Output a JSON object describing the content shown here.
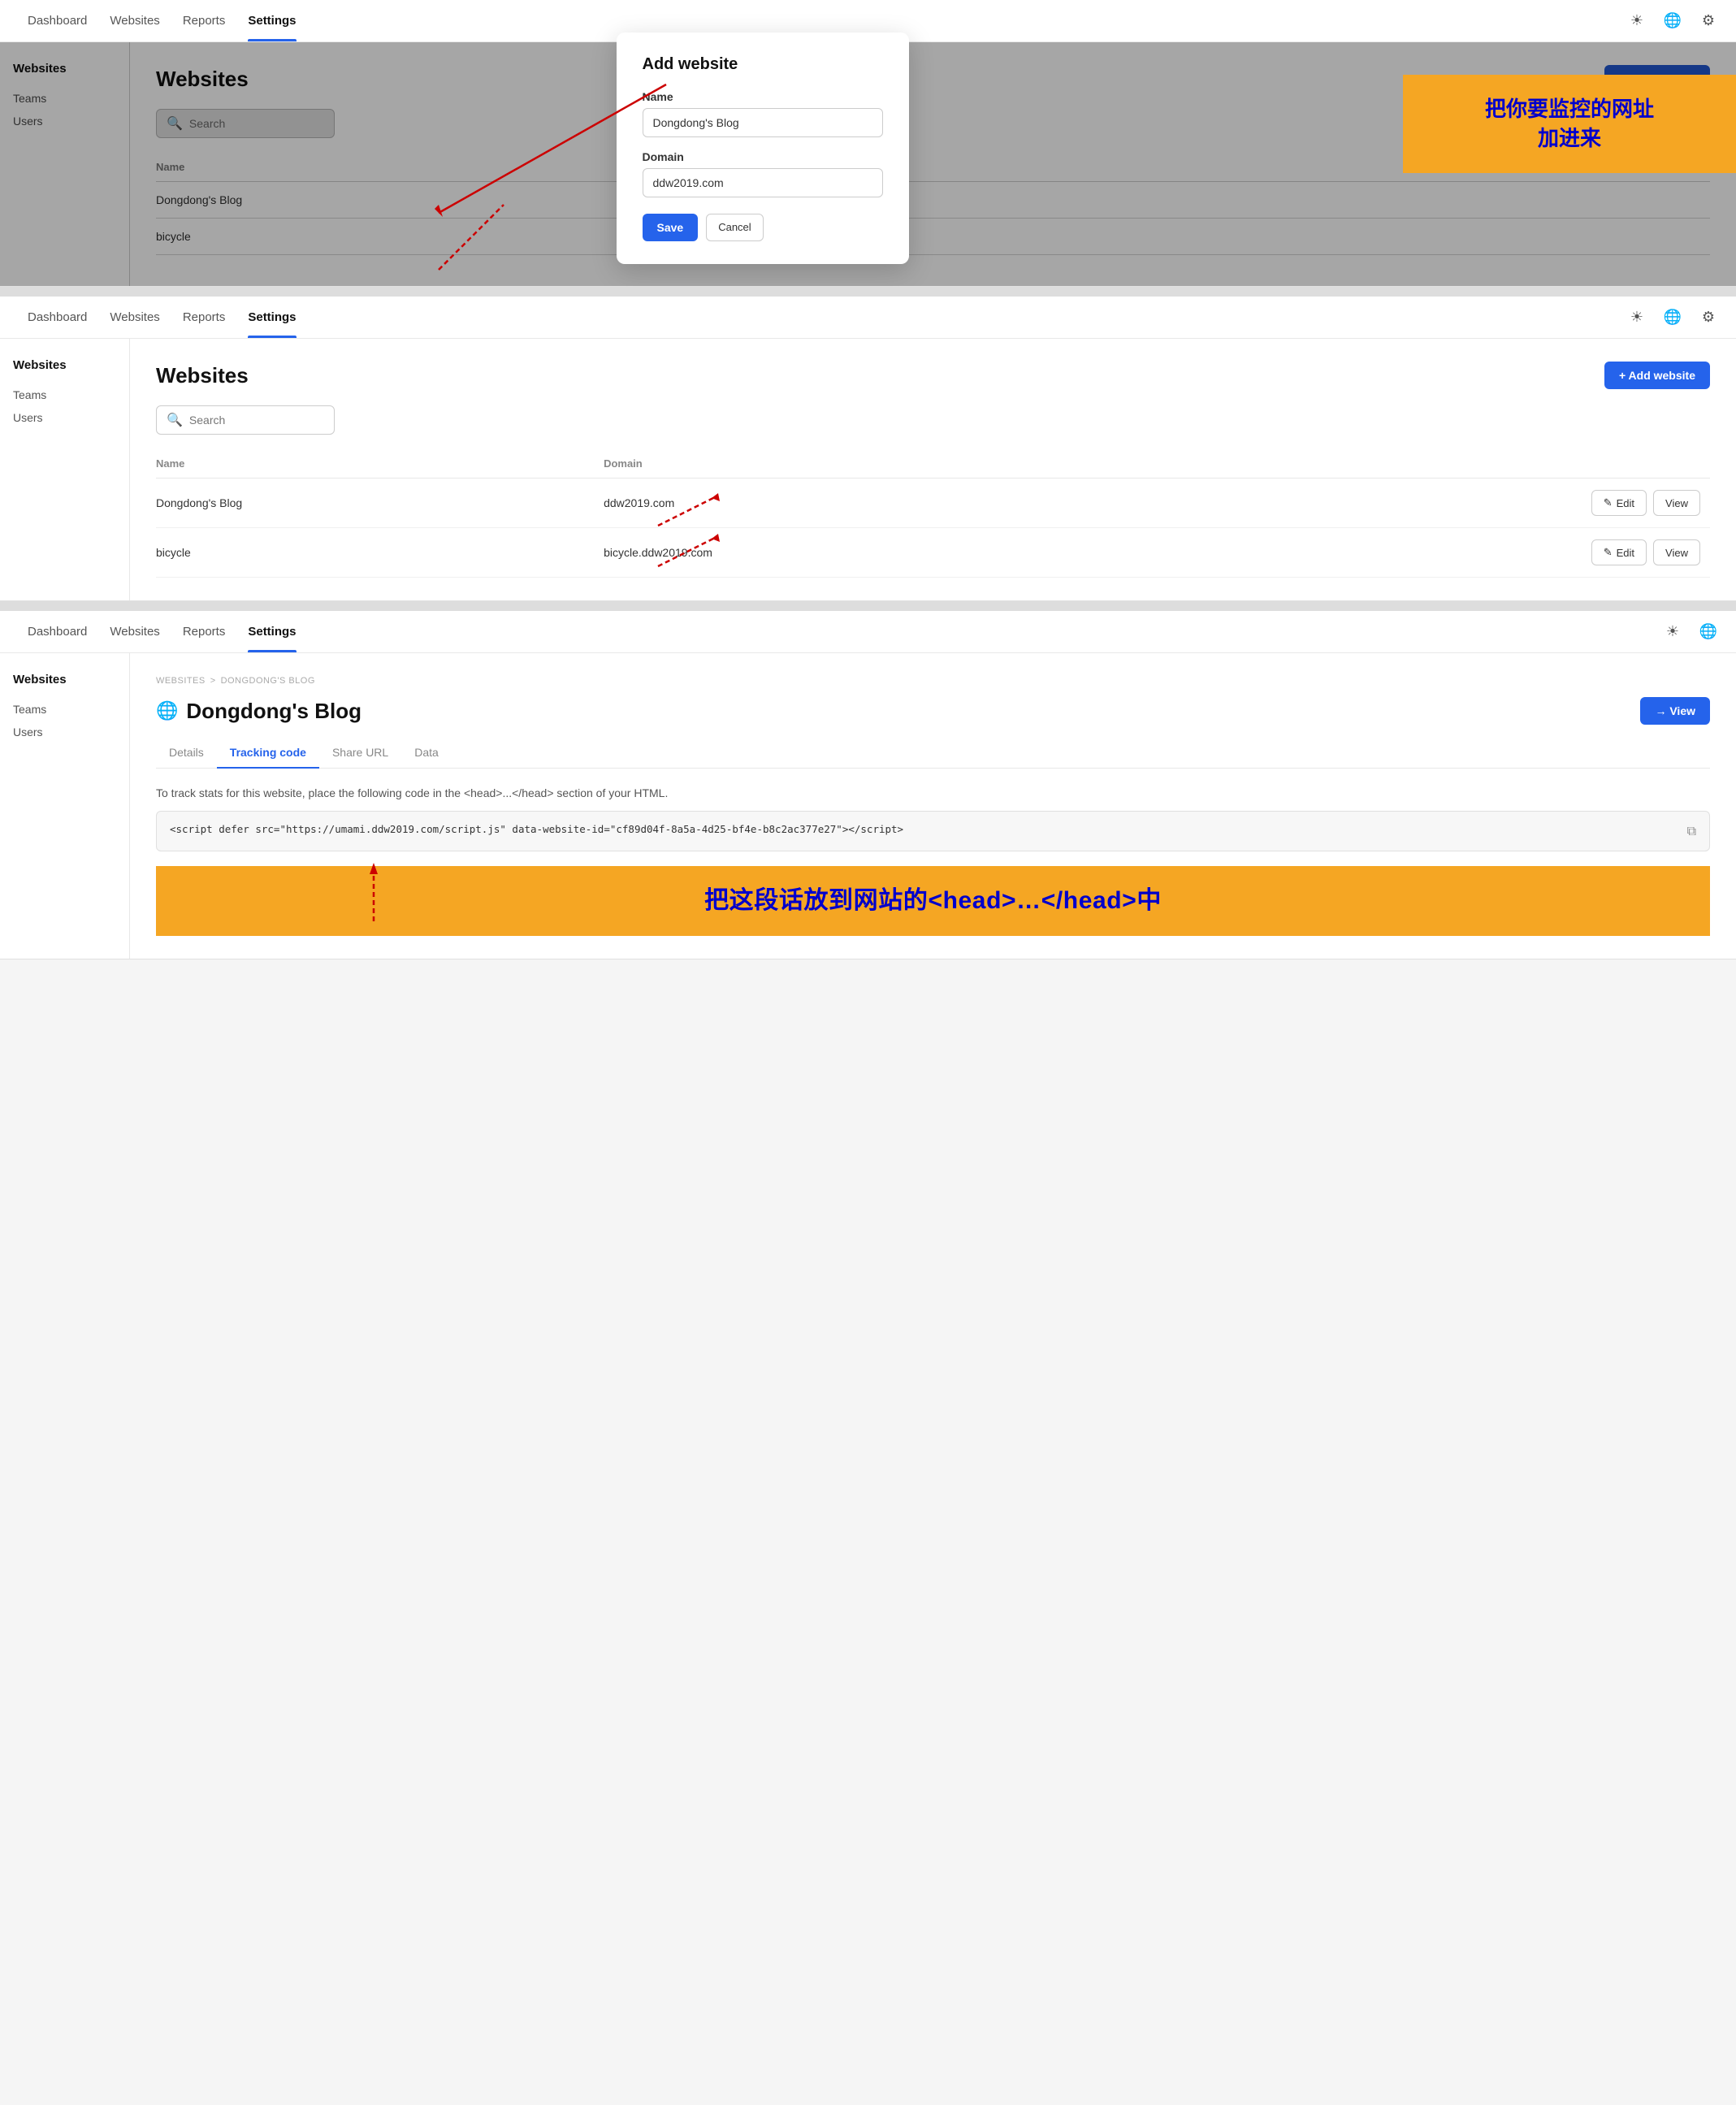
{
  "nav": {
    "items": [
      "Dashboard",
      "Websites",
      "Reports",
      "Settings"
    ],
    "active": "Settings"
  },
  "sidebar": {
    "title": "Websites",
    "items": [
      "Teams",
      "Users"
    ]
  },
  "panel1": {
    "section_title": "Websites",
    "add_button": "+ Add website",
    "search_placeholder": "Search",
    "columns": [
      "Name",
      ""
    ],
    "rows": [
      {
        "name": "Dongdong's Blog"
      },
      {
        "name": "bicycle"
      }
    ],
    "modal": {
      "title": "Add website",
      "name_label": "Name",
      "name_value": "Dongdong's Blog",
      "domain_label": "Domain",
      "domain_value": "ddw2019.com",
      "save_label": "Save",
      "cancel_label": "Cancel"
    },
    "annotation": "把你要监控的网址\n加进来"
  },
  "panel2": {
    "section_title": "Websites",
    "add_button": "+ Add website",
    "search_placeholder": "Search",
    "columns": [
      "Name",
      "Domain"
    ],
    "rows": [
      {
        "name": "Dongdong's Blog",
        "domain": "ddw2019.com"
      },
      {
        "name": "bicycle",
        "domain": "bicycle.ddw2019.com"
      }
    ],
    "edit_label": "Edit",
    "view_label": "View"
  },
  "panel3": {
    "breadcrumb": [
      "WEBSITES",
      ">",
      "DONGDONG'S BLOG"
    ],
    "site_name": "Dongdong's Blog",
    "view_label": "→ View",
    "tabs": [
      "Details",
      "Tracking code",
      "Share URL",
      "Data"
    ],
    "active_tab": "Tracking code",
    "track_desc": "To track stats for this website, place the following code in the <head>...</head> section of your HTML.",
    "code": "<script defer src=\"https://umami.ddw2019.com/script.js\" data-website-id=\"cf89d04f-8a5a-4d25-bf4e-b8c2ac377e27\"></script>",
    "annotation": "把这段话放到网站的<head>…</head>中"
  },
  "icons": {
    "sun": "☀",
    "globe": "🌐",
    "gear": "⚙",
    "search": "🔍",
    "copy": "⧉",
    "edit": "✎",
    "arrow_right": "→",
    "plus": "+",
    "globe2": "🌐"
  }
}
